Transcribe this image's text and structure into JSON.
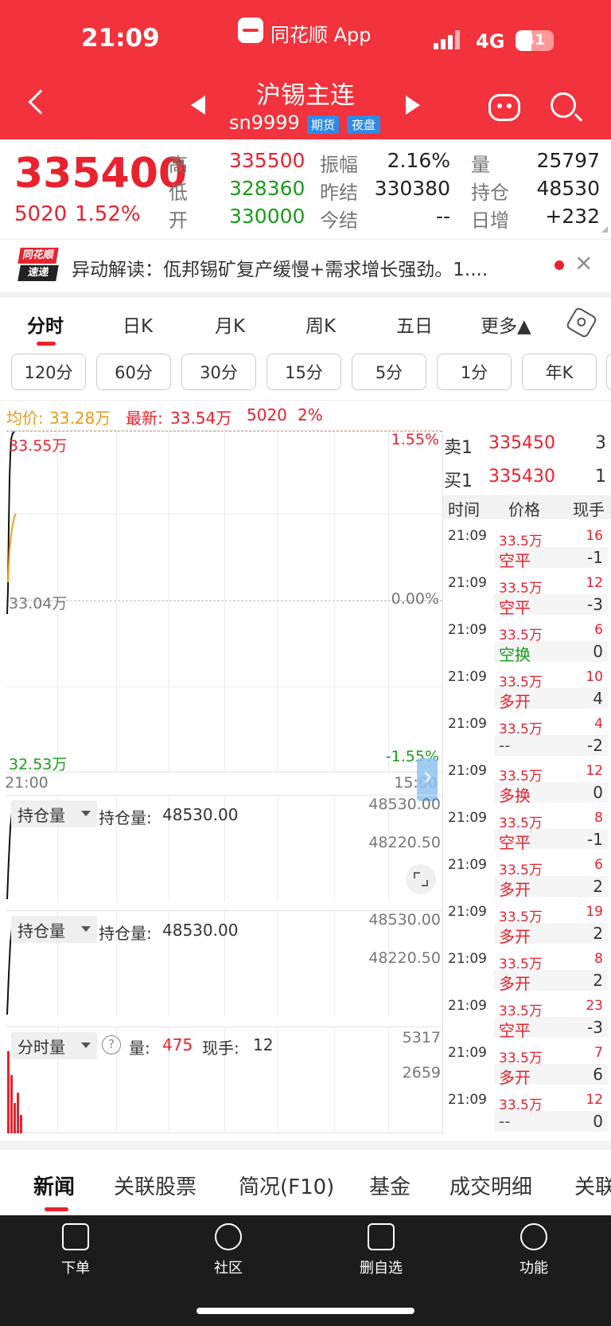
{
  "status_bar": {
    "time": "21:09",
    "app": "同花顺 App",
    "network": "4G",
    "battery": "41"
  },
  "header": {
    "title": "沪锡主连",
    "code": "sn9999",
    "badge1": "期货",
    "badge2": "夜盘"
  },
  "quote": {
    "price": "335400",
    "change": "5020",
    "change_pct": "1.52%",
    "high_label": "高",
    "high": "335500",
    "low_label": "低",
    "low": "328360",
    "open_label": "开",
    "open": "330000",
    "amplitude_label": "振幅",
    "amplitude": "2.16%",
    "prev_settle_label": "昨结",
    "prev_settle": "330380",
    "settle_label": "今结",
    "settle": "--",
    "volume_label": "量",
    "volume": "25797",
    "oi_label": "持仓",
    "oi": "48530",
    "daily_inc_label": "日增",
    "daily_inc": "+232"
  },
  "news": {
    "source_line1": "同花顺",
    "source_line2": "速递",
    "text": "异动解读：佤邦锡矿复产缓慢+需求增长强劲。1...."
  },
  "tabs": [
    "分时",
    "日K",
    "月K",
    "周K",
    "五日",
    "更多▲"
  ],
  "periods": [
    "120分",
    "60分",
    "30分",
    "15分",
    "5分",
    "1分",
    "年K"
  ],
  "info_line": {
    "avg_label": "均价:",
    "avg": "33.28万",
    "latest_label": "最新:",
    "latest": "33.54万",
    "chg": "5020",
    "pct": "2%"
  },
  "chart": {
    "top_price": "33.55万",
    "top_pct": "1.55%",
    "mid_price": "33.04万",
    "mid_pct": "0.00%",
    "bot_price": "32.53万",
    "bot_pct": "-1.55%",
    "time_start": "21:00",
    "time_end": "15:00"
  },
  "oi_panel1": {
    "dropdown": "持仓量",
    "label": "持仓量:",
    "value": "48530.00",
    "axis_top": "48530.00",
    "axis_bot": "48220.50"
  },
  "oi_panel2": {
    "dropdown": "持仓量",
    "label": "持仓量:",
    "value": "48530.00",
    "axis_top": "48530.00",
    "axis_bot": "48220.50"
  },
  "vol_panel": {
    "dropdown": "分时量",
    "help": "?",
    "vol_label": "量:",
    "vol": "475",
    "hand_label": "现手:",
    "hand": "12",
    "axis_top": "5317",
    "axis_mid": "2659"
  },
  "order_book": {
    "sell_label": "卖1",
    "sell_price": "335450",
    "sell_qty": "3",
    "buy_label": "买1",
    "buy_price": "335430",
    "buy_qty": "1"
  },
  "trades_header": {
    "time": "时间",
    "price": "价格",
    "qty": "现手"
  },
  "trades": [
    {
      "time": "21:09",
      "price": "33.5万",
      "qty": "16",
      "kind": "空平",
      "diff": "-1",
      "kc": "red"
    },
    {
      "time": "21:09",
      "price": "33.5万",
      "qty": "12",
      "kind": "空平",
      "diff": "-3",
      "kc": "red"
    },
    {
      "time": "21:09",
      "price": "33.5万",
      "qty": "6",
      "kind": "空换",
      "diff": "0",
      "kc": "green"
    },
    {
      "time": "21:09",
      "price": "33.5万",
      "qty": "10",
      "kind": "多开",
      "diff": "4",
      "kc": "red"
    },
    {
      "time": "21:09",
      "price": "33.5万",
      "qty": "4",
      "kind": "--",
      "diff": "-2",
      "kc": "grey"
    },
    {
      "time": "21:09",
      "price": "33.5万",
      "qty": "12",
      "kind": "多换",
      "diff": "0",
      "kc": "red"
    },
    {
      "time": "21:09",
      "price": "33.5万",
      "qty": "8",
      "kind": "空平",
      "diff": "-1",
      "kc": "red"
    },
    {
      "time": "21:09",
      "price": "33.5万",
      "qty": "6",
      "kind": "多开",
      "diff": "2",
      "kc": "red"
    },
    {
      "time": "21:09",
      "price": "33.5万",
      "qty": "19",
      "kind": "多开",
      "diff": "2",
      "kc": "red"
    },
    {
      "time": "21:09",
      "price": "33.5万",
      "qty": "8",
      "kind": "多开",
      "diff": "2",
      "kc": "red"
    },
    {
      "time": "21:09",
      "price": "33.5万",
      "qty": "23",
      "kind": "空平",
      "diff": "-3",
      "kc": "red"
    },
    {
      "time": "21:09",
      "price": "33.5万",
      "qty": "7",
      "kind": "多开",
      "diff": "6",
      "kc": "red"
    },
    {
      "time": "21:09",
      "price": "33.5万",
      "qty": "12",
      "kind": "--",
      "diff": "0",
      "kc": "grey"
    }
  ],
  "bottom_tabs": [
    "新闻",
    "关联股票",
    "简况(F10)",
    "基金",
    "成交明细",
    "关联"
  ],
  "bottom_nav": [
    {
      "label": "下单",
      "icon": "order-doc-icon"
    },
    {
      "label": "社区",
      "icon": "community-star-icon"
    },
    {
      "label": "删自选",
      "icon": "remove-watch-icon"
    },
    {
      "label": "功能",
      "icon": "menu-circle-icon"
    }
  ]
}
